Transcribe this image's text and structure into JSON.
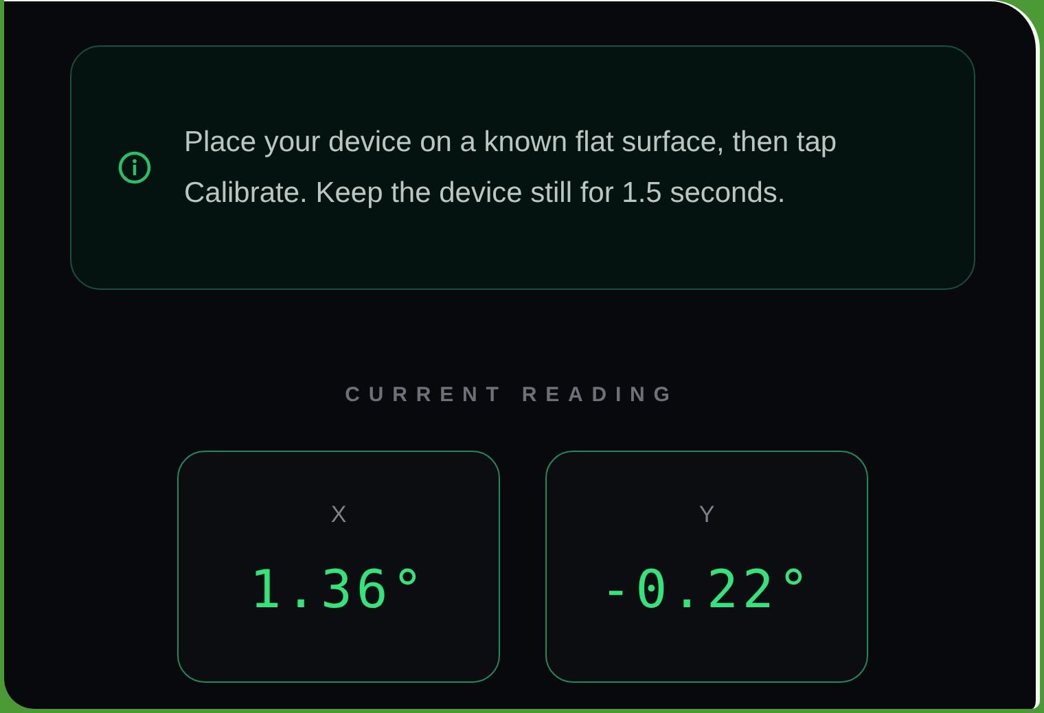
{
  "info_banner": {
    "text": "Place your device on a known flat surface, then tap Calibrate. Keep the device still for 1.5 seconds."
  },
  "section_title": "CURRENT READING",
  "readings": [
    {
      "axis": "X",
      "value": "1.36°"
    },
    {
      "axis": "Y",
      "value": "-0.22°"
    }
  ]
}
